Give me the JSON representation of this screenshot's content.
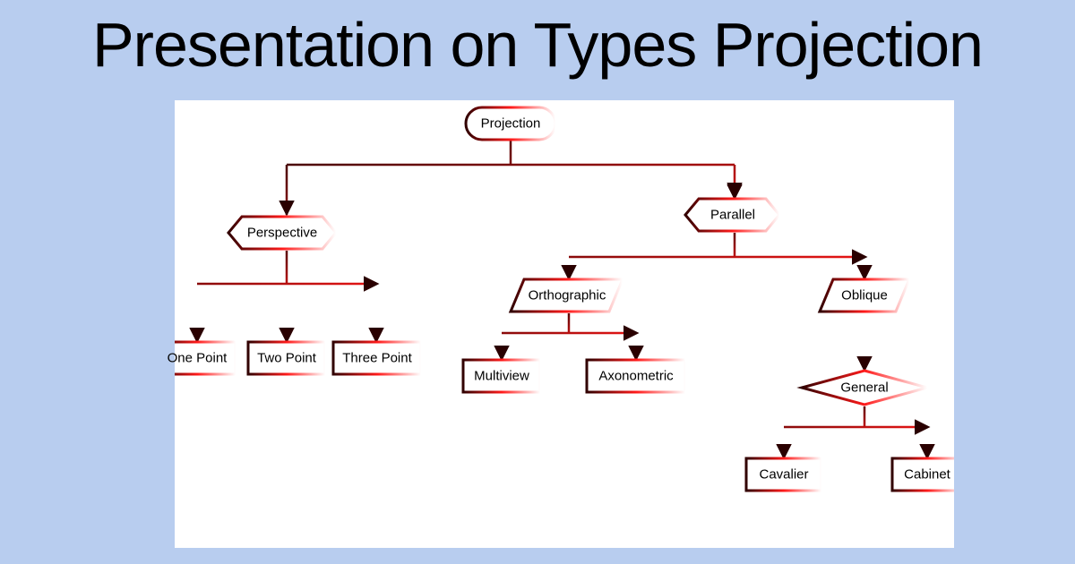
{
  "title": "Presentation on Types Projection",
  "nodes": {
    "root": "Projection",
    "perspective": "Perspective",
    "parallel": "Parallel",
    "onepoint": "One Point",
    "twopoint": "Two Point",
    "threepoint": "Three Point",
    "orthographic": "Orthographic",
    "oblique": "Oblique",
    "multiview": "Multiview",
    "axonometric": "Axonometric",
    "general": "General",
    "cavalier": "Cavalier",
    "cabinet": "Cabinet"
  }
}
